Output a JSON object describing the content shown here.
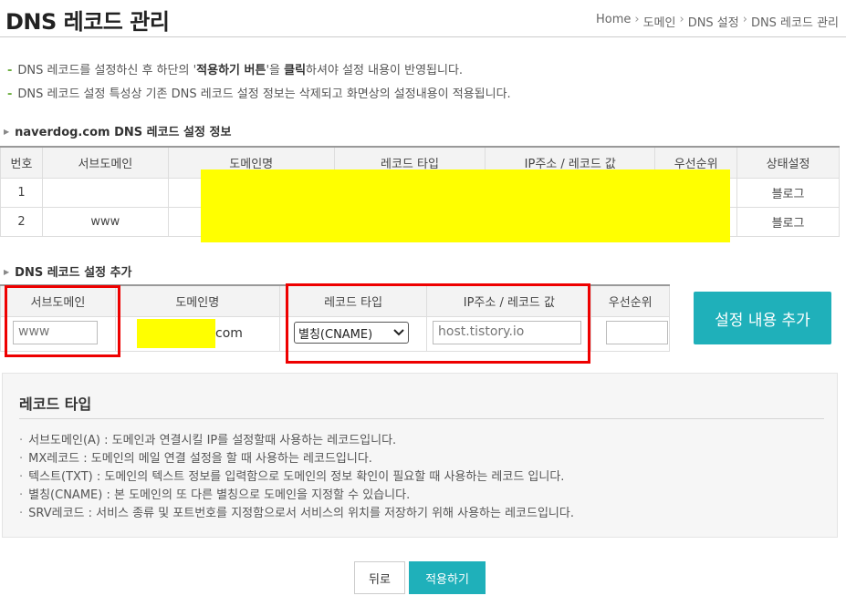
{
  "page": {
    "title": "DNS 레코드 관리",
    "breadcrumb": [
      "Home",
      "도메인",
      "DNS 설정",
      "DNS 레코드 관리"
    ]
  },
  "notices": {
    "n1_pre": "DNS 레코드를 설정하신 후 하단의 '",
    "n1_bold1": "적용하기 버튼",
    "n1_mid": "'을 ",
    "n1_bold2": "클릭",
    "n1_post": "하셔야 설정 내용이 반영됩니다.",
    "n2": "DNS 레코드 설정 특성상 기존 DNS 레코드 설정 정보는 삭제되고 화면상의 설정내용이 적용됩니다."
  },
  "records_section": {
    "label": "naverdog.com DNS 레코드 설정 정보",
    "headers": [
      "번호",
      "서브도메인",
      "도메인명",
      "레코드 타입",
      "IP주소 / 레코드 값",
      "우선순위",
      "상태설정"
    ],
    "rows": [
      {
        "no": "1",
        "sub": "",
        "status": "블로그"
      },
      {
        "no": "2",
        "sub": "www",
        "status": "블로그"
      }
    ]
  },
  "add_section": {
    "label": "DNS 레코드 설정 추가",
    "headers": [
      "서브도메인",
      "도메인명",
      "레코드 타입",
      "IP주소 / 레코드 값",
      "우선순위"
    ],
    "subdomain_value": "www",
    "domain_suffix": "com",
    "record_type_selected": "별칭(CNAME)",
    "ip_value": "host.tistory.io",
    "priority_value": "",
    "add_button": "설정 내용 추가"
  },
  "info": {
    "title": "레코드 타입",
    "items": [
      "서브도메인(A) : 도메인과 연결시킬 IP를 설정할때 사용하는 레코드입니다.",
      "MX레코드 : 도메인의 메일 연결 설정을 할 때 사용하는 레코드입니다.",
      "텍스트(TXT) : 도메인의 텍스트 정보를 입력함으로 도메인의 정보 확인이 필요할 때 사용하는 레코드 입니다.",
      "별칭(CNAME) : 본 도메인의 또 다른 별칭으로 도메인을 지정할 수 있습니다.",
      "SRV레코드 : 서비스 종류 및 포트번호를 지정함으로서 서비스의 위치를 저장하기 위해 사용하는 레코드입니다."
    ]
  },
  "buttons": {
    "back": "뒤로",
    "apply": "적용하기"
  },
  "colors": {
    "accent": "#1fb0ba",
    "highlight_box": "#ee0000",
    "redaction": "#ffff00",
    "bullet": "#6cae3f"
  },
  "icons": {
    "section_marker": "triangle-right-icon",
    "select_arrow": "chevron-down-icon"
  }
}
